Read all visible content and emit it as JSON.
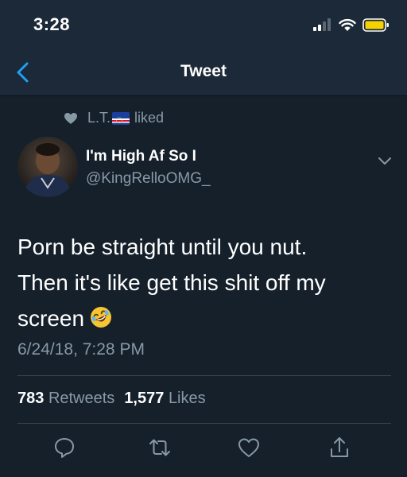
{
  "status_bar": {
    "time": "3:28",
    "icons": [
      "signal-icon",
      "wifi-icon",
      "battery-icon"
    ],
    "battery_color": "#f5d200"
  },
  "nav": {
    "title": "Tweet",
    "back_icon": "chevron-left-icon",
    "accent_color": "#1da1f2"
  },
  "social_context": {
    "user": "L.T.",
    "action": "liked"
  },
  "author": {
    "display_name": "I'm High Af So I",
    "handle": "@KingRelloOMG_"
  },
  "tweet": {
    "lines": [
      "Porn be straight until you nut.",
      "Then it's like get this shit off my",
      "screen"
    ],
    "emoji": "rolling-on-floor-laughing",
    "timestamp": "6/24/18, 7:28 PM"
  },
  "stats": {
    "retweets_count": "783",
    "retweets_label": "Retweets",
    "likes_count": "1,577",
    "likes_label": "Likes"
  },
  "actions": [
    "reply-icon",
    "retweet-icon",
    "like-icon",
    "share-icon"
  ]
}
